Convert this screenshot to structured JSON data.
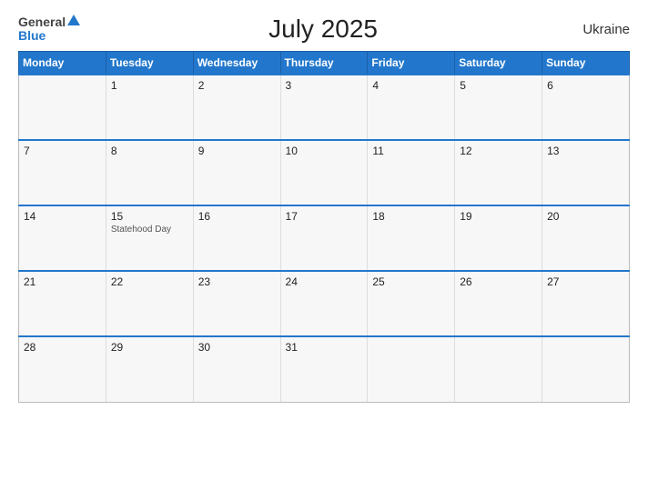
{
  "header": {
    "title": "July 2025",
    "country": "Ukraine",
    "logo_general": "General",
    "logo_blue": "Blue"
  },
  "days_of_week": [
    "Monday",
    "Tuesday",
    "Wednesday",
    "Thursday",
    "Friday",
    "Saturday",
    "Sunday"
  ],
  "weeks": [
    [
      {
        "num": "",
        "holiday": ""
      },
      {
        "num": "1",
        "holiday": ""
      },
      {
        "num": "2",
        "holiday": ""
      },
      {
        "num": "3",
        "holiday": ""
      },
      {
        "num": "4",
        "holiday": ""
      },
      {
        "num": "5",
        "holiday": ""
      },
      {
        "num": "6",
        "holiday": ""
      }
    ],
    [
      {
        "num": "7",
        "holiday": ""
      },
      {
        "num": "8",
        "holiday": ""
      },
      {
        "num": "9",
        "holiday": ""
      },
      {
        "num": "10",
        "holiday": ""
      },
      {
        "num": "11",
        "holiday": ""
      },
      {
        "num": "12",
        "holiday": ""
      },
      {
        "num": "13",
        "holiday": ""
      }
    ],
    [
      {
        "num": "14",
        "holiday": ""
      },
      {
        "num": "15",
        "holiday": "Statehood Day"
      },
      {
        "num": "16",
        "holiday": ""
      },
      {
        "num": "17",
        "holiday": ""
      },
      {
        "num": "18",
        "holiday": ""
      },
      {
        "num": "19",
        "holiday": ""
      },
      {
        "num": "20",
        "holiday": ""
      }
    ],
    [
      {
        "num": "21",
        "holiday": ""
      },
      {
        "num": "22",
        "holiday": ""
      },
      {
        "num": "23",
        "holiday": ""
      },
      {
        "num": "24",
        "holiday": ""
      },
      {
        "num": "25",
        "holiday": ""
      },
      {
        "num": "26",
        "holiday": ""
      },
      {
        "num": "27",
        "holiday": ""
      }
    ],
    [
      {
        "num": "28",
        "holiday": ""
      },
      {
        "num": "29",
        "holiday": ""
      },
      {
        "num": "30",
        "holiday": ""
      },
      {
        "num": "31",
        "holiday": ""
      },
      {
        "num": "",
        "holiday": ""
      },
      {
        "num": "",
        "holiday": ""
      },
      {
        "num": "",
        "holiday": ""
      }
    ]
  ]
}
